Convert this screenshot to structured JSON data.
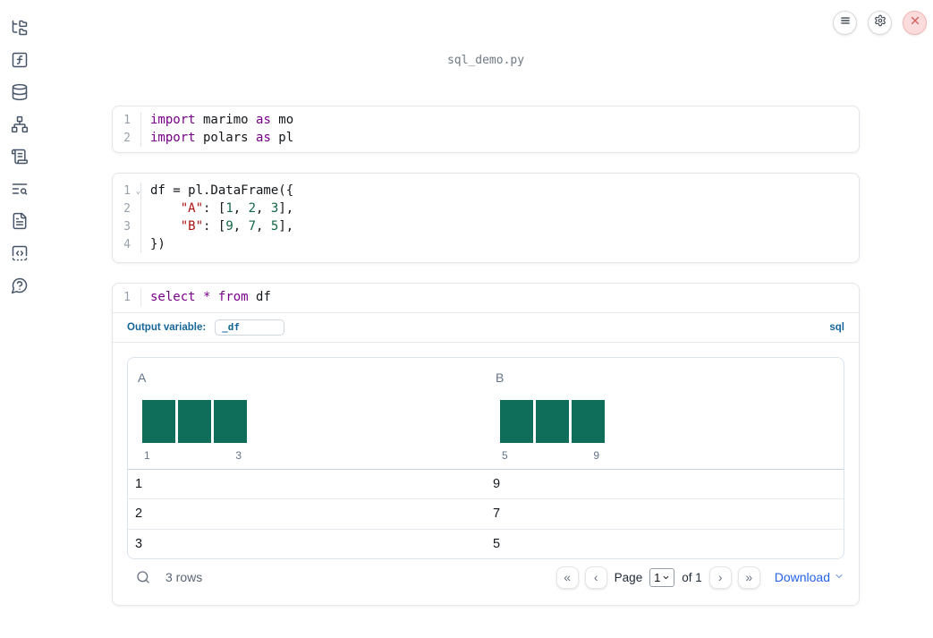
{
  "window": {
    "filename": "sql_demo.py",
    "toolbar": [
      {
        "name": "notebook-menu",
        "icon": "hamburger-icon"
      },
      {
        "name": "settings",
        "icon": "gear-icon"
      },
      {
        "name": "shutdown",
        "icon": "close-x-icon"
      }
    ]
  },
  "sidebar": {
    "items": [
      {
        "name": "file-explorer",
        "icon": "folder-tree-icon"
      },
      {
        "name": "variables",
        "icon": "function-square-icon"
      },
      {
        "name": "data-sources",
        "icon": "database-icon"
      },
      {
        "name": "dependencies",
        "icon": "network-icon"
      },
      {
        "name": "outline",
        "icon": "scroll-text-icon"
      },
      {
        "name": "logs",
        "icon": "text-search-icon"
      },
      {
        "name": "documentation",
        "icon": "file-text-icon"
      },
      {
        "name": "snippets",
        "icon": "code-square-dashed-icon"
      },
      {
        "name": "help",
        "icon": "message-question-icon"
      }
    ]
  },
  "colors": {
    "keyword": "#770088",
    "string": "#aa1111",
    "number": "#116644",
    "histogram_bar": "#0e6e59",
    "sql_accent": "#166699",
    "link_blue": "#2563eb",
    "shutdown_red": "#d65e5e"
  },
  "cells": [
    {
      "type": "code",
      "lines": [
        {
          "num": "1",
          "tokens": [
            {
              "t": "k",
              "v": "import"
            },
            {
              "t": "t",
              "v": " marimo "
            },
            {
              "t": "k",
              "v": "as"
            },
            {
              "t": "t",
              "v": " mo"
            }
          ]
        },
        {
          "num": "2",
          "tokens": [
            {
              "t": "k",
              "v": "import"
            },
            {
              "t": "t",
              "v": " polars "
            },
            {
              "t": "k",
              "v": "as"
            },
            {
              "t": "t",
              "v": " pl"
            }
          ]
        }
      ]
    },
    {
      "type": "code",
      "lines": [
        {
          "num": "1",
          "fold": true,
          "tokens": [
            {
              "t": "t",
              "v": "df = pl.DataFrame({"
            }
          ]
        },
        {
          "num": "2",
          "tokens": [
            {
              "t": "t",
              "v": "    "
            },
            {
              "t": "s",
              "v": "\"A\""
            },
            {
              "t": "t",
              "v": ": ["
            },
            {
              "t": "n",
              "v": "1"
            },
            {
              "t": "t",
              "v": ", "
            },
            {
              "t": "n",
              "v": "2"
            },
            {
              "t": "t",
              "v": ", "
            },
            {
              "t": "n",
              "v": "3"
            },
            {
              "t": "t",
              "v": "],"
            }
          ]
        },
        {
          "num": "3",
          "tokens": [
            {
              "t": "t",
              "v": "    "
            },
            {
              "t": "s",
              "v": "\"B\""
            },
            {
              "t": "t",
              "v": ": ["
            },
            {
              "t": "n",
              "v": "9"
            },
            {
              "t": "t",
              "v": ", "
            },
            {
              "t": "n",
              "v": "7"
            },
            {
              "t": "t",
              "v": ", "
            },
            {
              "t": "n",
              "v": "5"
            },
            {
              "t": "t",
              "v": "],"
            }
          ]
        },
        {
          "num": "4",
          "tokens": [
            {
              "t": "t",
              "v": "})"
            }
          ]
        }
      ]
    },
    {
      "type": "sql",
      "lines": [
        {
          "num": "1",
          "tokens": [
            {
              "t": "k",
              "v": "select"
            },
            {
              "t": "t",
              "v": " "
            },
            {
              "t": "k",
              "v": "*"
            },
            {
              "t": "t",
              "v": " "
            },
            {
              "t": "k",
              "v": "from"
            },
            {
              "t": "t",
              "v": " df"
            }
          ]
        }
      ],
      "output_variable_label": "Output variable:",
      "output_variable_value": "_df",
      "language_badge": "sql",
      "table": {
        "chart_data": {
          "type": "bar",
          "note": "per-column value histograms",
          "series": [
            {
              "name": "A",
              "values": [
                1,
                1,
                1
              ],
              "min_label": "1",
              "max_label": "3"
            },
            {
              "name": "B",
              "values": [
                1,
                1,
                1
              ],
              "min_label": "5",
              "max_label": "9"
            }
          ]
        },
        "columns": [
          {
            "name": "A",
            "histogram": {
              "bars": [
                1,
                1,
                1
              ],
              "min_label": "1",
              "max_label": "3"
            }
          },
          {
            "name": "B",
            "histogram": {
              "bars": [
                1,
                1,
                1
              ],
              "min_label": "5",
              "max_label": "9"
            }
          }
        ],
        "rows": [
          [
            "1",
            "9"
          ],
          [
            "2",
            "7"
          ],
          [
            "3",
            "5"
          ]
        ],
        "footer": {
          "row_count": "3 rows",
          "first_icon": "«",
          "prev_icon": "‹",
          "page_label": "Page",
          "page_value": "1",
          "total_label": "of 1",
          "next_icon": "›",
          "last_icon": "»",
          "download_label": "Download"
        }
      }
    }
  ]
}
